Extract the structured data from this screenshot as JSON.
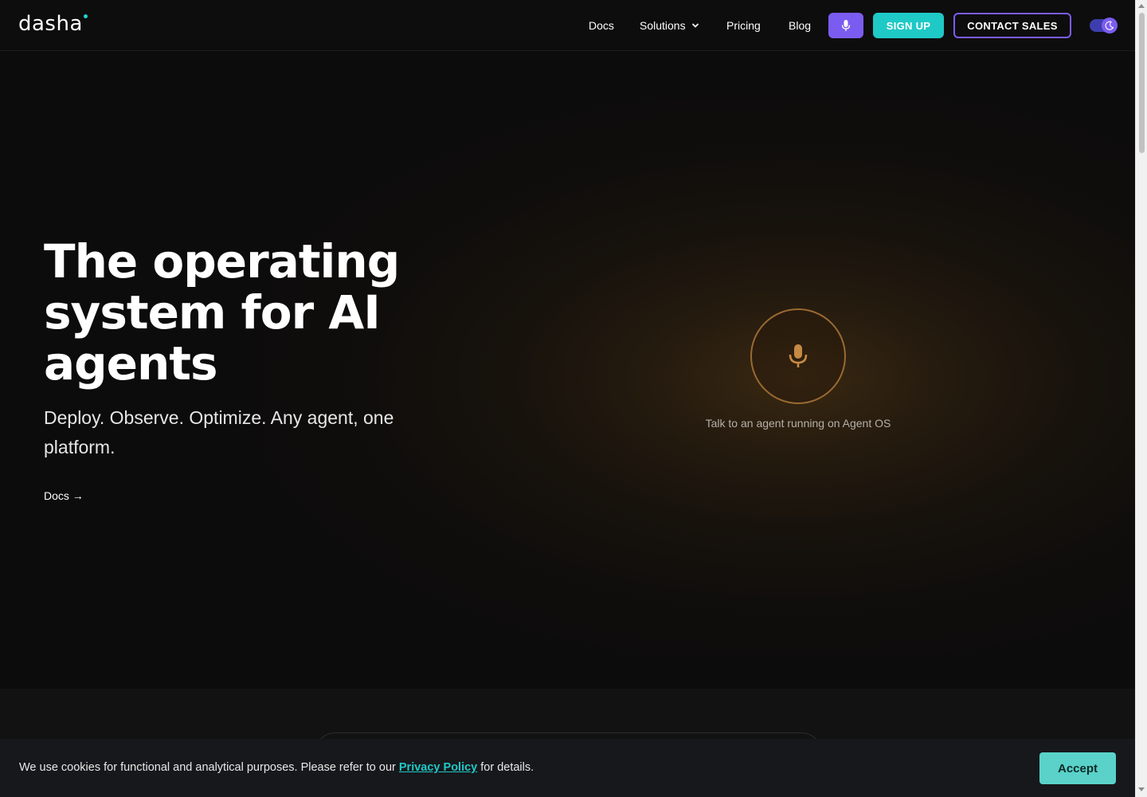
{
  "header": {
    "logo": "dasha",
    "nav": {
      "docs": "Docs",
      "solutions": "Solutions",
      "pricing": "Pricing",
      "blog": "Blog"
    },
    "signup": "SIGN UP",
    "contact": "CONTACT SALES",
    "icons": [
      "microphone-icon",
      "chevron-down-icon",
      "moon-icon"
    ]
  },
  "hero": {
    "title": "The operating system for AI agents",
    "subtitle": "Deploy. Observe. Optimize. Any agent, one platform.",
    "docs_link": "Docs →",
    "agent_caption": "Talk to an agent running on Agent OS"
  },
  "cookie": {
    "text_before": "We use cookies for functional and analytical purposes. Please refer to our ",
    "link": "Privacy Policy",
    "text_after": " for details.",
    "accept": "Accept"
  },
  "colors": {
    "accent_purple": "#7b5cf0",
    "accent_teal": "#1fc9c6",
    "accept": "#5ad2c9",
    "mic_glow": "#9a6a32"
  }
}
